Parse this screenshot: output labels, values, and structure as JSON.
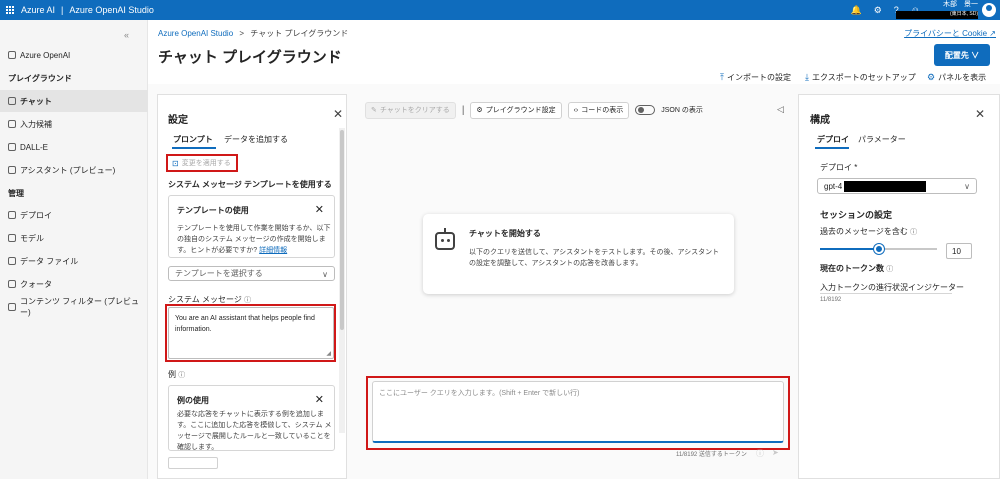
{
  "topbar": {
    "brand": "Azure AI",
    "separator": "|",
    "studio": "Azure OpenAI Studio",
    "user_name": "木部　景一",
    "user_org": "(東日本, SD)"
  },
  "leftnav": {
    "azure_openai": "Azure OpenAI",
    "section_playground": "プレイグラウンド",
    "items_playground": [
      {
        "label": "チャット",
        "icon": "chat-icon"
      },
      {
        "label": "入力候補",
        "icon": "completions-icon"
      },
      {
        "label": "DALL-E",
        "icon": "image-icon"
      },
      {
        "label": "アシスタント (プレビュー)",
        "icon": "assistant-icon"
      }
    ],
    "section_manage": "管理",
    "items_manage": [
      {
        "label": "デプロイ",
        "icon": "deploy-icon"
      },
      {
        "label": "モデル",
        "icon": "model-icon"
      },
      {
        "label": "データ ファイル",
        "icon": "file-icon"
      },
      {
        "label": "クォータ",
        "icon": "quota-icon"
      },
      {
        "label": "コンテンツ フィルター (プレビュー)",
        "icon": "shield-icon"
      }
    ]
  },
  "header": {
    "breadcrumb_root": "Azure OpenAI Studio",
    "breadcrumb_sep": ">",
    "breadcrumb_current": "チャット プレイグラウンド",
    "title": "チャット プレイグラウンド",
    "privacy": "プライバシーと Cookie",
    "deploy_button": "配置先 ∨",
    "import": "インポートの設定",
    "export": "エクスポートのセットアップ",
    "panels": "パネルを表示"
  },
  "settings": {
    "title": "設定",
    "tab_prompt": "プロンプト",
    "tab_add_data": "データを追加する",
    "apply_changes": "変更を適用する",
    "use_template_heading": "システム メッセージ テンプレートを使用する",
    "template_card_title": "テンプレートの使用",
    "template_card_body": "テンプレートを使用して作業を開始するか、以下の独自のシステム メッセージの作成を開始します。ヒントが必要ですか?",
    "template_card_link": "詳細情報",
    "template_select_placeholder": "テンプレートを選択する",
    "system_message_label": "システム メッセージ",
    "system_message_value": "You are an AI assistant that helps people find information.",
    "examples_label": "例",
    "examples_card_title": "例の使用",
    "examples_card_body": "必要な応答をチャットに表示する例を追加します。ここに追加した応答を模倣して、システム メッセージで展開したルールと一致していることを確認します。"
  },
  "chat": {
    "clear_chat": "チャットをクリアする",
    "playground_settings": "プレイグラウンド設定",
    "view_code": "コードの表示",
    "json_view": "JSON の表示",
    "start_title": "チャットを開始する",
    "start_body": "以下のクエリを送信して、アシスタントをテストします。その後、アシスタントの設定を調整して、アシスタントの応答を改善します。",
    "input_placeholder": "ここにユーザー クエリを入力します。(Shift + Enter で新しい行)",
    "token_count": "11/8192 送信するトークン"
  },
  "config": {
    "title": "構成",
    "tab_deploy": "デプロイ",
    "tab_params": "パラメーター",
    "deploy_label": "デプロイ *",
    "deploy_value": "gpt-4",
    "session_heading": "セッションの設定",
    "past_messages_label": "過去のメッセージを含む",
    "past_messages_value": "10",
    "past_messages_fraction": 0.5,
    "token_heading": "現在のトークン数",
    "token_progress_label": "入力トークンの進行状況インジケーター",
    "token_progress_value": "11/8192"
  },
  "colors": {
    "brand": "#0f6cbd",
    "highlight": "#d01818"
  }
}
